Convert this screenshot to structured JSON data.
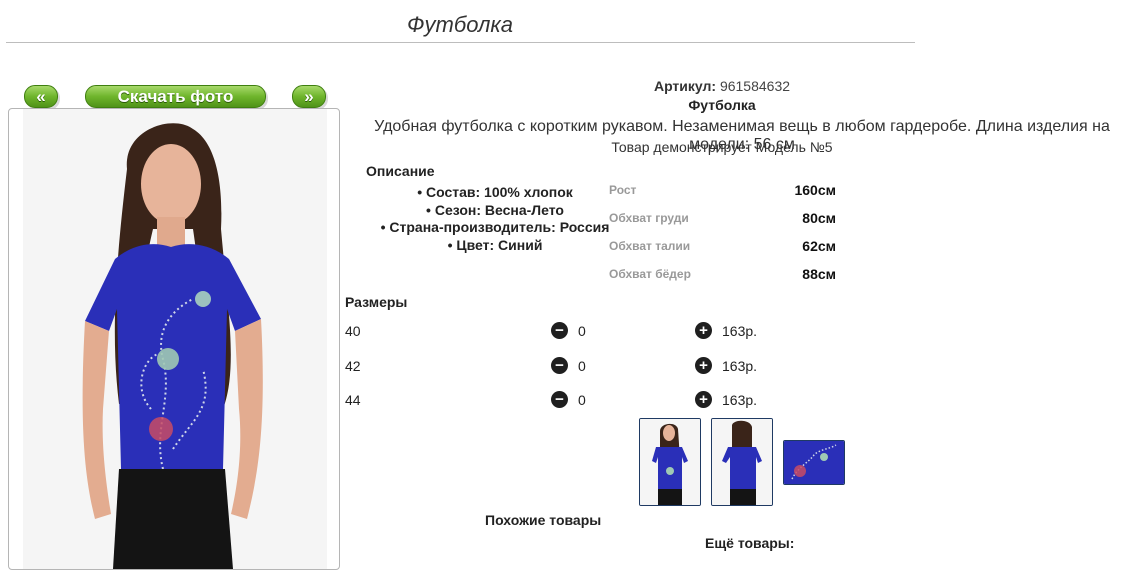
{
  "header": {
    "title": "Футболка"
  },
  "gallery": {
    "prev_label": "«",
    "download_label": "Скачать фото",
    "next_label": "»"
  },
  "product": {
    "article_label": "Артикул:",
    "article_value": "961584632",
    "name": "Футболка",
    "description": "Удобная футболка с коротким рукавом. Незаменимая вещь в любом гардеробе. Длина изделия на модели: 56 см",
    "model_note": "Товар демонстрирует Модель №5"
  },
  "details": {
    "title": "Описание",
    "items": [
      "Состав: 100% хлопок",
      "Сезон: Весна-Лето",
      "Страна-производитель: Россия",
      "Цвет: Синий"
    ]
  },
  "measurements": [
    {
      "label": "Рост",
      "value": "160см"
    },
    {
      "label": "Обхват груди",
      "value": "80см"
    },
    {
      "label": "Обхват талии",
      "value": "62см"
    },
    {
      "label": "Обхват бёдер",
      "value": "88см"
    }
  ],
  "sizes": {
    "title": "Размеры",
    "rows": [
      {
        "size": "40",
        "qty": "0",
        "price": "163р."
      },
      {
        "size": "42",
        "qty": "0",
        "price": "163р."
      },
      {
        "size": "44",
        "qty": "0",
        "price": "163р."
      }
    ]
  },
  "footer": {
    "similar_label": "Похожие товары",
    "more_label": "Ещё товары:"
  },
  "colors": {
    "accent_green": "#6fb52c",
    "shirt_blue": "#2a2fb8",
    "thumb_border": "#1f3a63"
  }
}
